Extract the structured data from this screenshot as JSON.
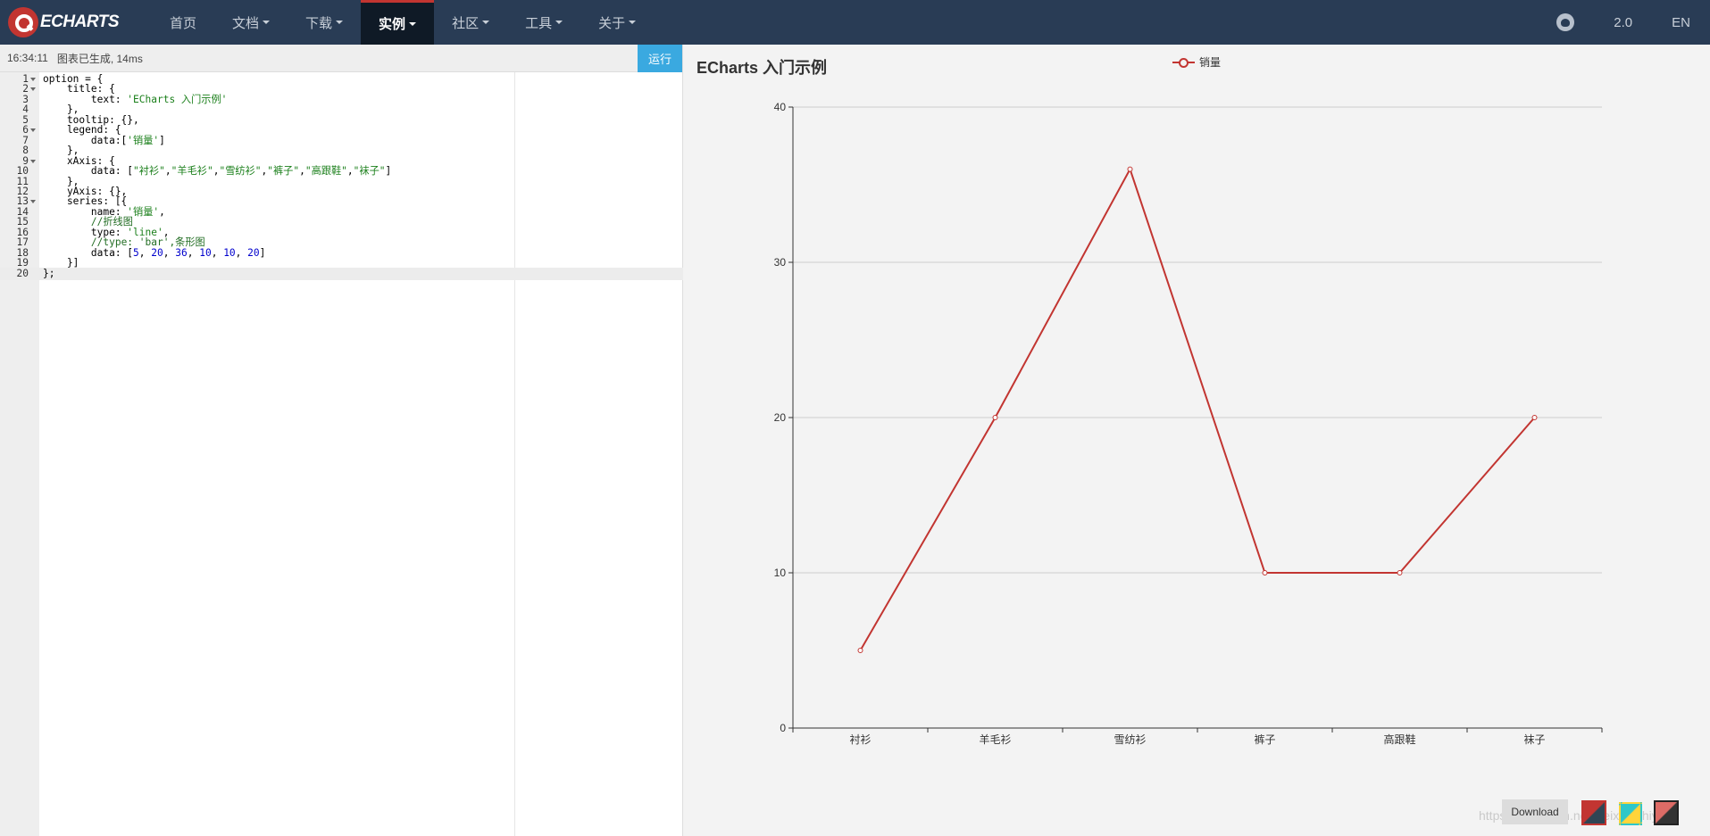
{
  "navbar": {
    "logo_text": "ECHARTS",
    "items": [
      {
        "label": "首页",
        "caret": false
      },
      {
        "label": "文档",
        "caret": true
      },
      {
        "label": "下载",
        "caret": true
      },
      {
        "label": "实例",
        "caret": true
      },
      {
        "label": "社区",
        "caret": true
      },
      {
        "label": "工具",
        "caret": true
      },
      {
        "label": "关于",
        "caret": true
      }
    ],
    "active_index": 3,
    "version": "2.0",
    "lang": "EN",
    "github_icon": "github-icon"
  },
  "editor": {
    "status_time": "16:34:11",
    "status_text": "图表已生成, 14ms",
    "run_label": "运行",
    "current_line": 20,
    "lines": [
      {
        "n": "1",
        "fold": true,
        "html": "option = {"
      },
      {
        "n": "2",
        "fold": true,
        "html": "    title: {"
      },
      {
        "n": "3",
        "fold": false,
        "html": "        text: <span class=\"s\">'ECharts 入门示例'</span>"
      },
      {
        "n": "4",
        "fold": false,
        "html": "    },"
      },
      {
        "n": "5",
        "fold": false,
        "html": "    tooltip: {},"
      },
      {
        "n": "6",
        "fold": true,
        "html": "    legend: {"
      },
      {
        "n": "7",
        "fold": false,
        "html": "        data:[<span class=\"s\">'销量'</span>]"
      },
      {
        "n": "8",
        "fold": false,
        "html": "    },"
      },
      {
        "n": "9",
        "fold": true,
        "html": "    xAxis: {"
      },
      {
        "n": "10",
        "fold": false,
        "html": "        data: [<span class=\"s\">\"衬衫\"</span>,<span class=\"s\">\"羊毛衫\"</span>,<span class=\"s\">\"雪纺衫\"</span>,<span class=\"s\">\"裤子\"</span>,<span class=\"s\">\"高跟鞋\"</span>,<span class=\"s\">\"袜子\"</span>]"
      },
      {
        "n": "11",
        "fold": false,
        "html": "    },"
      },
      {
        "n": "12",
        "fold": false,
        "html": "    yAxis: {},"
      },
      {
        "n": "13",
        "fold": true,
        "html": "    series: [{"
      },
      {
        "n": "14",
        "fold": false,
        "html": "        name: <span class=\"s\">'销量'</span>,"
      },
      {
        "n": "15",
        "fold": false,
        "html": "        <span class=\"c\">//折线图</span>"
      },
      {
        "n": "16",
        "fold": false,
        "html": "        type: <span class=\"s\">'line'</span>,"
      },
      {
        "n": "17",
        "fold": false,
        "html": "        <span class=\"c\">//type: 'bar',条形图</span>"
      },
      {
        "n": "18",
        "fold": false,
        "html": "        data: [<span class=\"n\">5</span>, <span class=\"n\">20</span>, <span class=\"n\">36</span>, <span class=\"n\">10</span>, <span class=\"n\">10</span>, <span class=\"n\">20</span>]"
      },
      {
        "n": "19",
        "fold": false,
        "html": "    }]"
      },
      {
        "n": "20",
        "fold": false,
        "html": "};"
      }
    ]
  },
  "chart_data": {
    "type": "line",
    "title": "ECharts 入门示例",
    "legend": [
      "销量"
    ],
    "legend_position": "top-center",
    "categories": [
      "衬衫",
      "羊毛衫",
      "雪纺衫",
      "裤子",
      "高跟鞋",
      "袜子"
    ],
    "series": [
      {
        "name": "销量",
        "values": [
          5,
          20,
          36,
          10,
          10,
          20
        ]
      }
    ],
    "ylim": [
      0,
      40
    ],
    "yticks": [
      0,
      10,
      20,
      30,
      40
    ],
    "grid": true,
    "color": "#c23531"
  },
  "toolbox": {
    "download_label": "Download",
    "themes": [
      "theme-default-icon",
      "theme-light-icon",
      "theme-dark-icon"
    ]
  },
  "watermark": "https://blog.csdn.net/weixin_zhiyu_e"
}
